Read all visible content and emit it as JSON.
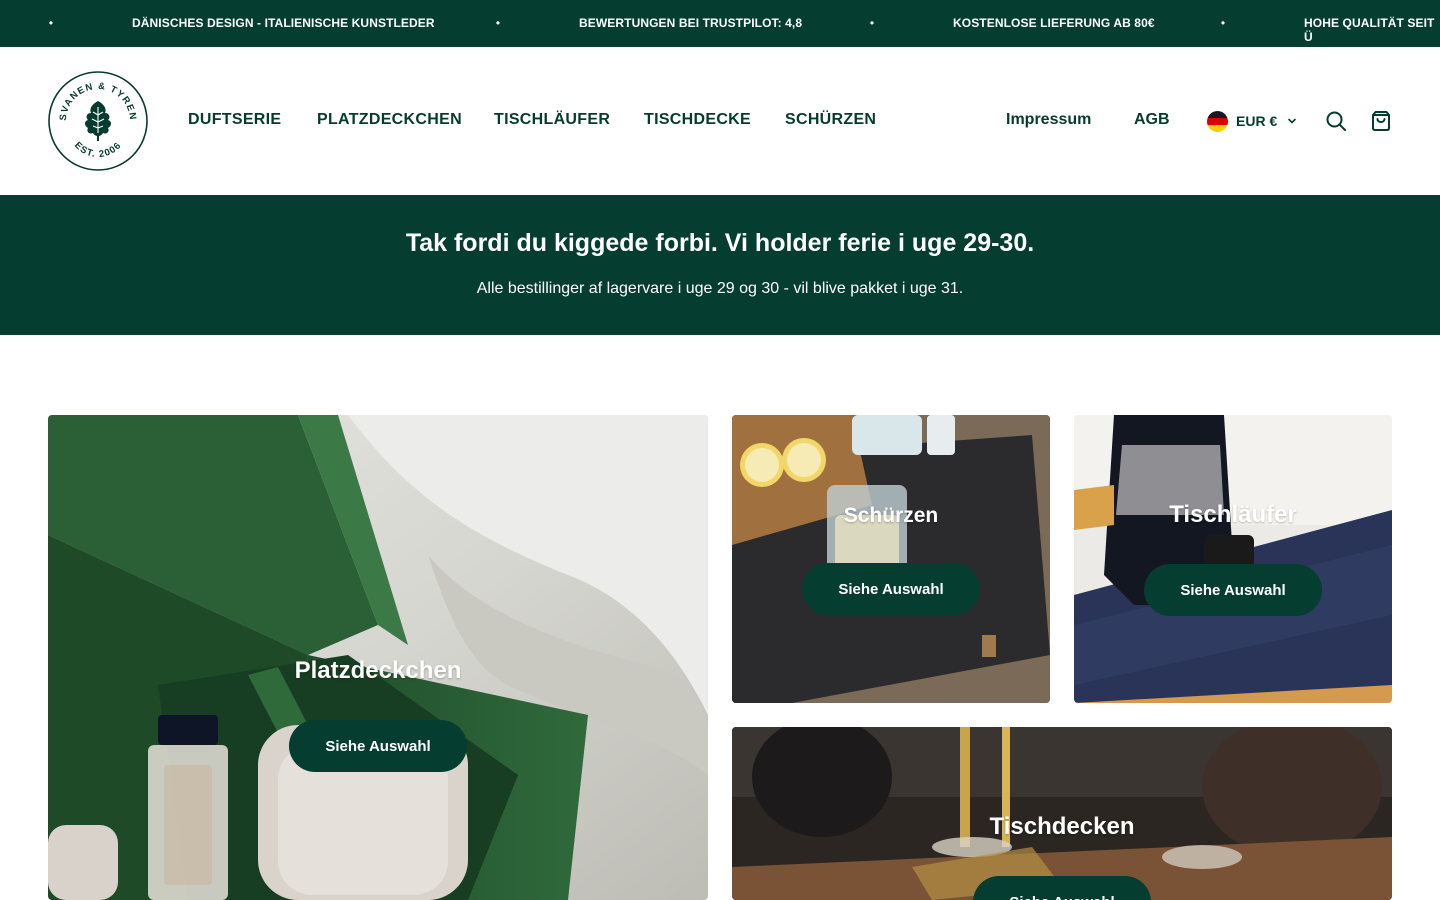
{
  "announcement": {
    "items": [
      "DÄNISCHES DESIGN - ITALIENISCHE KUNSTLEDER",
      "BEWERTUNGEN BEI TRUSTPILOT: 4,8",
      "KOSTENLOSE LIEFERUNG AB 80€",
      "HOHE QUALITÄT SEIT Ü"
    ]
  },
  "logo": {
    "top_text": "SVANEN & TYREN",
    "bottom_text": "EST. 2006"
  },
  "nav": {
    "items": [
      "DUFTSERIE",
      "PLATZDECKCHEN",
      "TISCHLÄUFER",
      "TISCHDECKE",
      "SCHÜRZEN"
    ],
    "impressum": "Impressum",
    "agb": "AGB",
    "currency": "EUR €",
    "flag": "germany-flag"
  },
  "banner": {
    "title": "Tak fordi du kiggede forbi. Vi holder ferie i uge 29-30.",
    "subtitle": "Alle bestillinger af lagervare i uge 29 og 30 - vil blive pakket i uge 31."
  },
  "collections": [
    {
      "title": "Platzdeckchen",
      "button": "Siehe Auswahl"
    },
    {
      "title": "Schürzen",
      "button": "Siehe Auswahl"
    },
    {
      "title": "Tischläufer",
      "button": "Siehe Auswahl"
    },
    {
      "title": "Tischdecken",
      "button": "Siehe Auswahl"
    }
  ],
  "colors": {
    "brand_green": "#053d30",
    "text_green": "#063b2f",
    "white": "#ffffff"
  }
}
